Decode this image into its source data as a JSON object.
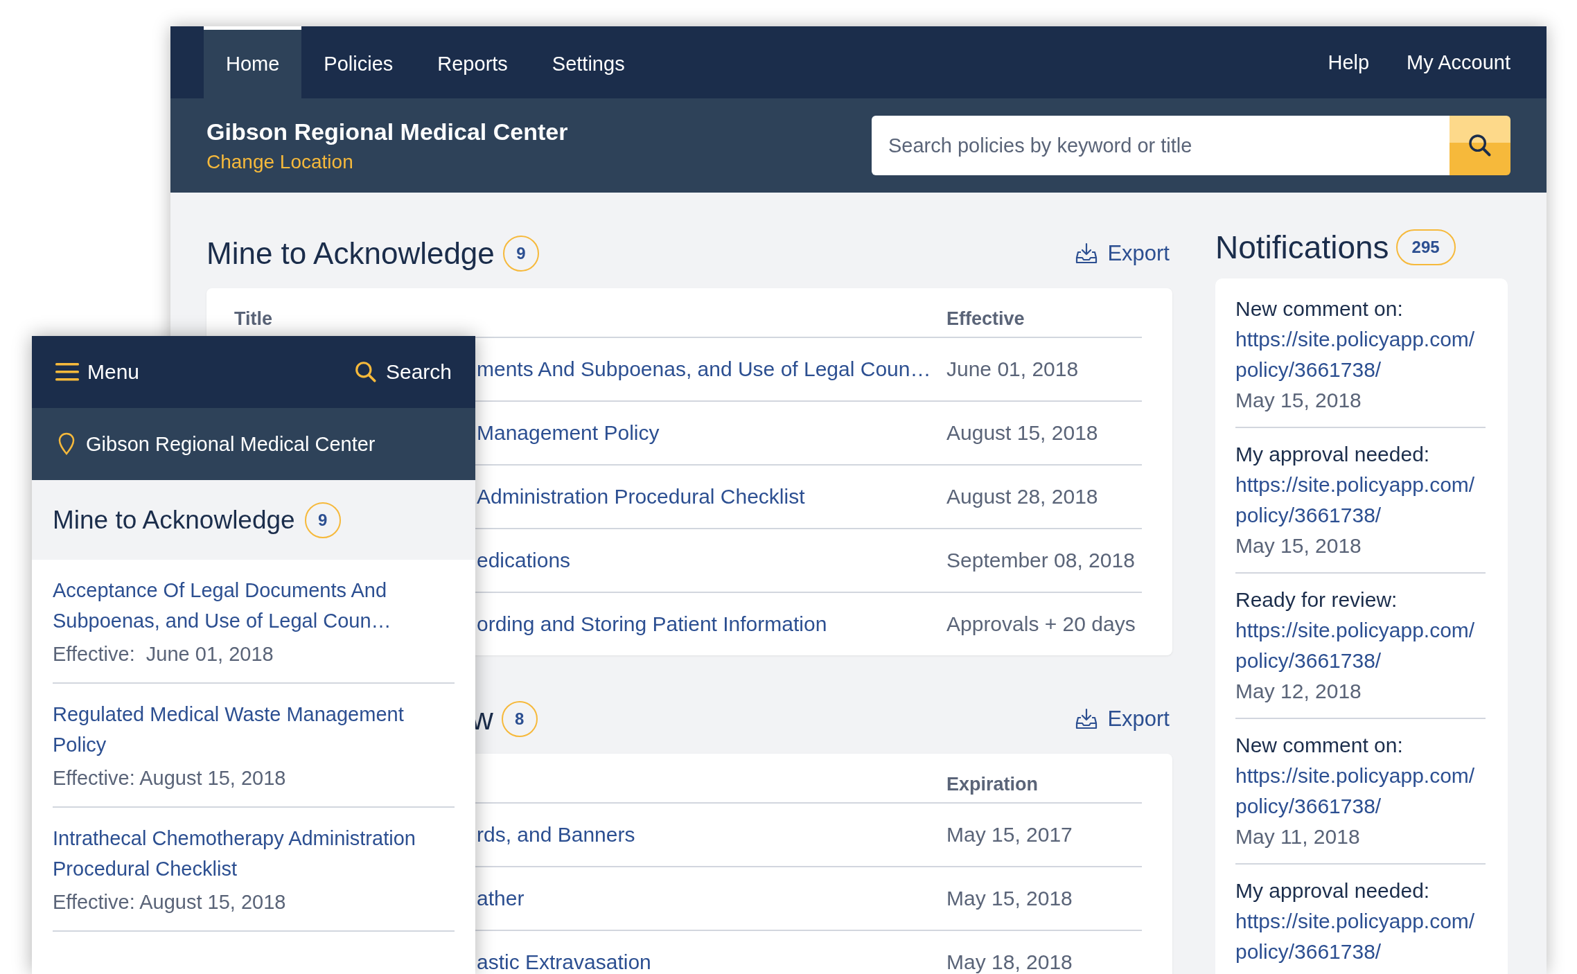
{
  "desktop": {
    "nav_tabs": [
      {
        "label": "Home",
        "selected": true
      },
      {
        "label": "Policies",
        "selected": false
      },
      {
        "label": "Reports",
        "selected": false
      },
      {
        "label": "Settings",
        "selected": false
      }
    ],
    "nav_links": [
      "Help",
      "My Account"
    ],
    "location": {
      "name": "Gibson Regional Medical Center",
      "change_link": "Change Location"
    },
    "search": {
      "placeholder": "Search policies by keyword or title"
    },
    "sections": [
      {
        "heading": "Mine to Acknowledge",
        "count": "9",
        "export": "Export",
        "title_header": "Title",
        "date_header": "Effective",
        "rows": [
          {
            "title": "ments And Subpoenas, and Use of Legal Coun…",
            "date": "June 01, 2018"
          },
          {
            "title": "Management Policy",
            "date": "August 15, 2018"
          },
          {
            "title": "Administration Procedural Checklist",
            "date": "August 28, 2018"
          },
          {
            "title": "edications",
            "date": "September 08, 2018"
          },
          {
            "title": "ording and Storing Patient Information",
            "date": "Approvals + 20 days"
          }
        ]
      },
      {
        "heading": "w",
        "count": "8",
        "export": "Export",
        "date_header": "Expiration",
        "rows": [
          {
            "title": "rds, and Banners",
            "date": "May 15, 2017"
          },
          {
            "title": "ather",
            "date": "May 15, 2018"
          },
          {
            "title": "astic Extravasation",
            "date": "May 18, 2018"
          }
        ]
      }
    ],
    "notifications": {
      "title": "Notifications",
      "count": "295",
      "items": [
        {
          "event": "New comment on:",
          "link": "https://site.policyapp.com/ policy/3661738/",
          "date": "May 15, 2018"
        },
        {
          "event": "My approval needed:",
          "link": "https://site.policyapp.com/ policy/3661738/",
          "date": "May 15, 2018"
        },
        {
          "event": "Ready for review:",
          "link": "https://site.policyapp.com/ policy/3661738/",
          "date": "May 12, 2018"
        },
        {
          "event": "New comment on:",
          "link": "https://site.policyapp.com/ policy/3661738/",
          "date": "May 11, 2018"
        },
        {
          "event": "My approval needed:",
          "link": "https://site.policyapp.com/ policy/3661738/"
        }
      ]
    }
  },
  "mobile": {
    "menu": "Menu",
    "search": "Search",
    "location": "Gibson Regional Medical Center",
    "section": {
      "heading": "Mine to Acknowledge",
      "count": "9",
      "items": [
        {
          "title": "Acceptance Of Legal Documents And Subpoenas, and Use of Legal Coun…",
          "effective": "Effective:  June 01, 2018"
        },
        {
          "title": "Regulated Medical Waste Management Policy",
          "effective": "Effective: August 15, 2018"
        },
        {
          "title": "Intrathecal Chemotherapy Administration Procedural Checklist",
          "effective": "Effective: August 15, 2018"
        }
      ]
    }
  }
}
